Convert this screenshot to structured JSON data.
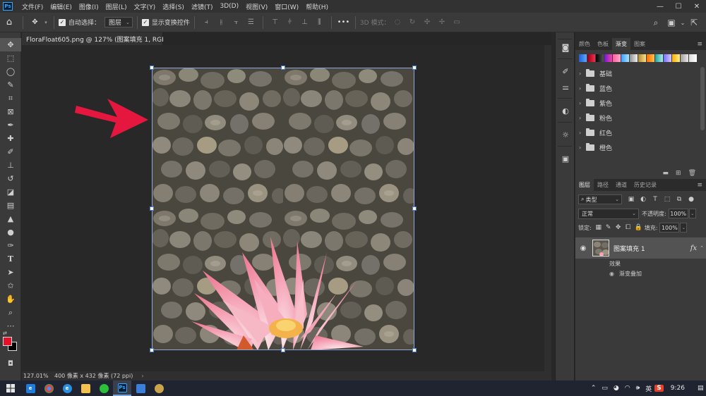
{
  "menubar": {
    "logo": "Ps",
    "items": [
      "文件(F)",
      "编辑(E)",
      "图像(I)",
      "图层(L)",
      "文字(Y)",
      "选择(S)",
      "滤镜(T)",
      "3D(D)",
      "视图(V)",
      "窗口(W)",
      "帮助(H)"
    ],
    "minimize": "—",
    "maximize": "☐",
    "close": "✕"
  },
  "options": {
    "auto_select_label": "自动选择：",
    "auto_select_value": "图层",
    "show_transform_label": "显示变换控件",
    "mode_3d_label": "3D 模式：",
    "more": "•••"
  },
  "document": {
    "tab_title": "FloraFloat605.png @ 127% (图案填充 1, RGB/8) *",
    "close": "×"
  },
  "status": {
    "zoom": "127.01%",
    "info": "400 像素 x 432 像素 (72 ppi)",
    "arrow": "›"
  },
  "gradient_panel": {
    "tabs": [
      "颜色",
      "色板",
      "渐变",
      "图案"
    ],
    "active_tab": "渐变",
    "swatch_colors": [
      "#2060e0",
      "#c0102a",
      "#1a1a1a",
      "#8a2be2",
      "#ff69b4",
      "#4da6ff",
      "#cfcfcf",
      "#e0c060",
      "#ff8c00",
      "#50c8c8",
      "#a0a0ff",
      "#ffd700",
      "#c8c8c8",
      "#f0f0f0"
    ],
    "folders": [
      "基础",
      "蓝色",
      "紫色",
      "粉色",
      "红色",
      "橙色"
    ]
  },
  "layers_panel": {
    "tabs": [
      "图层",
      "路径",
      "通道",
      "历史记录"
    ],
    "active_tab": "图层",
    "kind_filter": "类型",
    "blend_mode": "正常",
    "opacity_label": "不透明度:",
    "opacity_value": "100%",
    "lock_label": "锁定:",
    "fill_label": "填充:",
    "fill_value": "100%",
    "layer_name": "图案填充 1",
    "fx": "fx",
    "effects_label": "效果",
    "effect_name": "渐变叠加"
  },
  "taskbar": {
    "clock": "9:26",
    "ime": "英",
    "tray_s": "S"
  },
  "colors": {
    "foreground": "#e5102a",
    "background": "#000000",
    "annotation_arrow": "#e5173f"
  }
}
